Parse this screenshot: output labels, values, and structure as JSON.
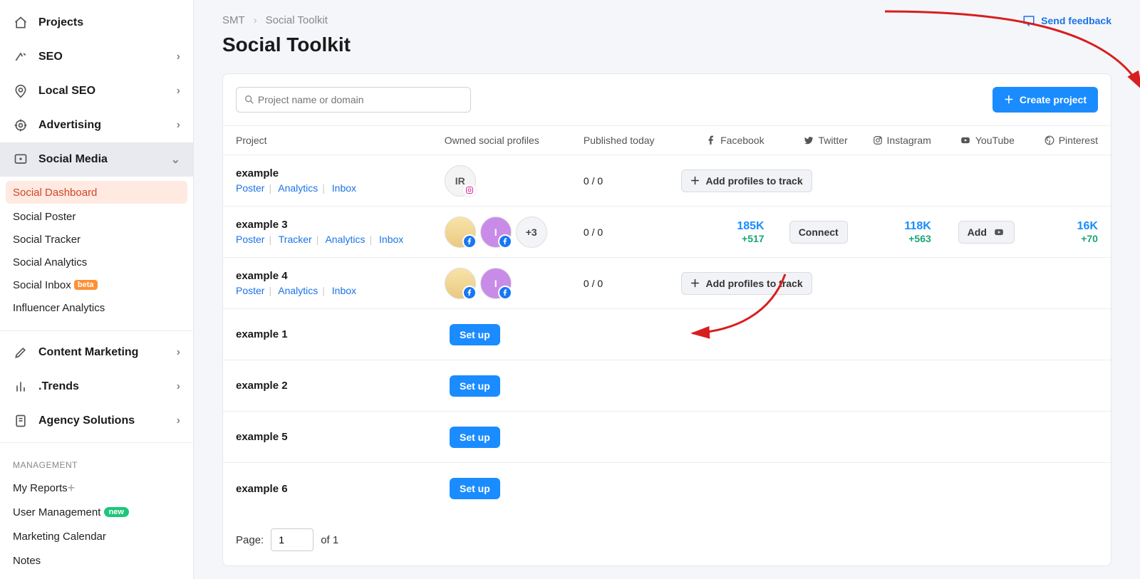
{
  "sidebar": {
    "projects": "Projects",
    "seo": "SEO",
    "local_seo": "Local SEO",
    "advertising": "Advertising",
    "social_media": "Social Media",
    "sub": {
      "dashboard": "Social Dashboard",
      "poster": "Social Poster",
      "tracker": "Social Tracker",
      "analytics": "Social Analytics",
      "inbox": "Social Inbox",
      "inbox_badge": "beta",
      "influencer": "Influencer Analytics"
    },
    "content_marketing": "Content Marketing",
    "trends": ".Trends",
    "agency": "Agency Solutions",
    "management_head": "MANAGEMENT",
    "my_reports": "My Reports",
    "user_mgmt": "User Management",
    "user_mgmt_badge": "new",
    "calendar": "Marketing Calendar",
    "notes": "Notes"
  },
  "header": {
    "crumb1": "SMT",
    "crumb2": "Social Toolkit",
    "title": "Social Toolkit",
    "feedback": "Send feedback"
  },
  "toolbar": {
    "search_placeholder": "Project name or domain",
    "create_project": "Create project"
  },
  "columns": {
    "project": "Project",
    "profiles": "Owned social profiles",
    "published": "Published today",
    "facebook": "Facebook",
    "twitter": "Twitter",
    "instagram": "Instagram",
    "youtube": "YouTube",
    "pinterest": "Pinterest"
  },
  "links": {
    "poster": "Poster",
    "tracker": "Tracker",
    "analytics": "Analytics",
    "inbox": "Inbox"
  },
  "buttons": {
    "add_profiles": "Add profiles to track",
    "connect": "Connect",
    "add": "Add",
    "setup": "Set up"
  },
  "rows": {
    "r1": {
      "name": "example",
      "avatar_text": "IR",
      "published": "0 / 0"
    },
    "r2": {
      "name": "example 3",
      "overflow": "+3",
      "published": "0 / 0",
      "fb_value": "185K",
      "fb_delta": "+517",
      "ig_value": "118K",
      "ig_delta": "+563",
      "pin_value": "16K",
      "pin_delta": "+70"
    },
    "r3": {
      "name": "example 4",
      "published": "0 / 0"
    },
    "r4": {
      "name": "example 1"
    },
    "r5": {
      "name": "example 2"
    },
    "r6": {
      "name": "example 5"
    },
    "r7": {
      "name": "example 6"
    }
  },
  "pagination": {
    "label": "Page:",
    "value": "1",
    "suffix": "of 1"
  }
}
